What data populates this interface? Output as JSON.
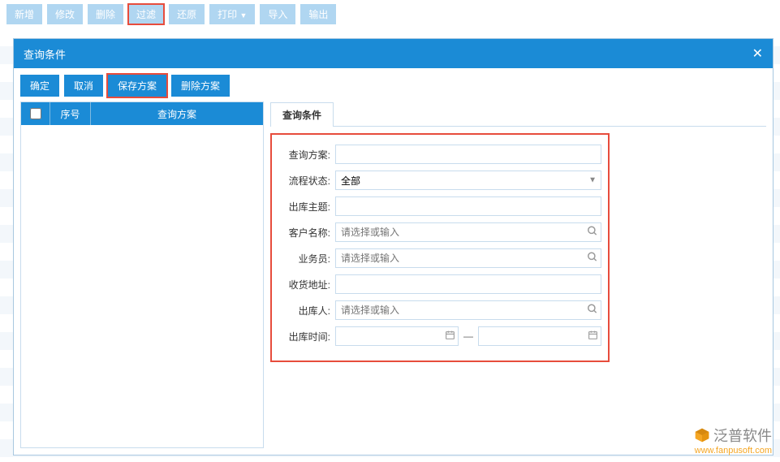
{
  "toolbar": {
    "new": "新增",
    "edit": "修改",
    "delete": "删除",
    "filter": "过滤",
    "restore": "还原",
    "print": "打印",
    "import": "导入",
    "export": "输出"
  },
  "modal": {
    "title": "查询条件",
    "buttons": {
      "ok": "确定",
      "cancel": "取消",
      "save": "保存方案",
      "delete": "删除方案"
    },
    "leftHeaders": {
      "seq": "序号",
      "plan": "查询方案"
    },
    "tab": "查询条件",
    "form": {
      "labels": {
        "plan": "查询方案:",
        "status": "流程状态:",
        "topic": "出库主题:",
        "customer": "客户名称:",
        "sales": "业务员:",
        "address": "收货地址:",
        "outperson": "出库人:",
        "time": "出库时间:"
      },
      "statusValue": "全部",
      "placeholder": "请选择或输入",
      "dateSep": "—"
    }
  },
  "watermark": {
    "brand": "泛普软件",
    "url": "www.fanpusoft.com"
  }
}
